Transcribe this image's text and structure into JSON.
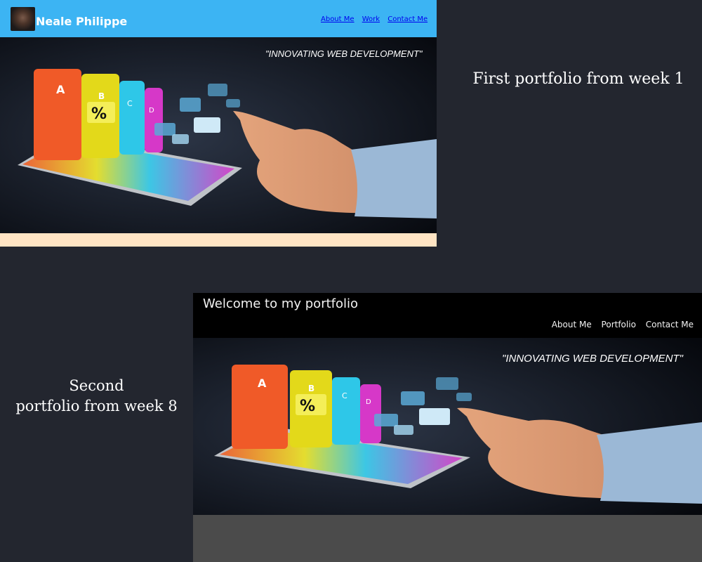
{
  "portfolio_one": {
    "brand": "Neale Philippe",
    "nav_links": [
      "About Me",
      "Work",
      "Contact Me"
    ],
    "tagline": "\"INNOVATING WEB DEVELOPMENT\""
  },
  "portfolio_two": {
    "title": "Welcome to my portfolio",
    "nav_links": [
      "About Me",
      "Portfolio",
      "Contact Me"
    ],
    "tagline": "\"INNOVATING WEB DEVELOPMENT\""
  },
  "captions": {
    "first": "First portfolio from week 1",
    "second_line1": "Second",
    "second_line2": "portfolio from week 8"
  },
  "hero_tiles": [
    "A",
    "B",
    "C",
    "D"
  ],
  "hero_percent": "%",
  "colors": {
    "nav_blue": "#3cb4f3",
    "peach": "#ffe4c4",
    "background": "#23262f"
  }
}
